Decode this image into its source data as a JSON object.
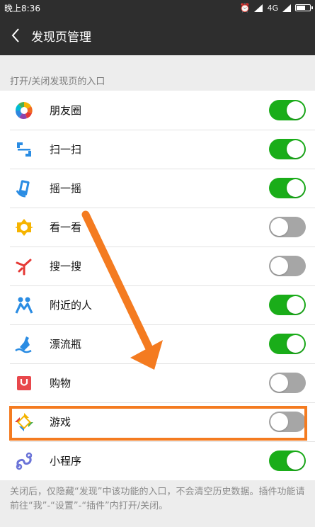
{
  "status_bar": {
    "time": "晚上8:36",
    "network": "4G"
  },
  "header": {
    "title": "发现页管理"
  },
  "section": {
    "label": "打开/关闭发现页的入口"
  },
  "items": [
    {
      "label": "朋友圈",
      "icon": "moments-icon",
      "enabled": true
    },
    {
      "label": "扫一扫",
      "icon": "scan-icon",
      "enabled": true
    },
    {
      "label": "摇一摇",
      "icon": "shake-icon",
      "enabled": true
    },
    {
      "label": "看一看",
      "icon": "top-stories-icon",
      "enabled": false
    },
    {
      "label": "搜一搜",
      "icon": "search-icon",
      "enabled": false
    },
    {
      "label": "附近的人",
      "icon": "people-nearby-icon",
      "enabled": true
    },
    {
      "label": "漂流瓶",
      "icon": "drift-bottle-icon",
      "enabled": true
    },
    {
      "label": "购物",
      "icon": "shopping-icon",
      "enabled": false
    },
    {
      "label": "游戏",
      "icon": "games-icon",
      "enabled": false
    },
    {
      "label": "小程序",
      "icon": "mini-programs-icon",
      "enabled": true
    }
  ],
  "footer": {
    "note": "关闭后，仅隐藏“发现”中该功能的入口，不会清空历史数据。插件功能请前往“我”-“设置”-“插件”内打开/关闭。"
  },
  "colors": {
    "toggle_on": "#1aad19",
    "toggle_off": "#a6a6a6",
    "annotation": "#f47b20"
  }
}
